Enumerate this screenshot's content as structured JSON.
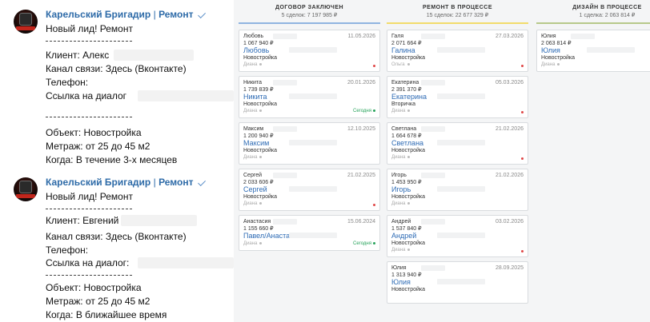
{
  "chat": {
    "messages": [
      {
        "sender": "Карельский Бригадир",
        "sender_suffix": "Ремонт",
        "lines": [
          "Новый лид! Ремонт",
          "Клиент: Алекс",
          "Канал связи: Здесь (Вконтакте)",
          "Телефон:",
          "Ссылка на диалог",
          "Объект: Новостройка",
          "Метраж: от 25 до 45 м2",
          "Когда: В течение 3-х месяцев"
        ]
      },
      {
        "sender": "Карельский Бригадир",
        "sender_suffix": "Ремонт",
        "lines": [
          "Новый лид! Ремонт",
          "Клиент: Евгений",
          "Канал связи: Здесь (Вконтакте)",
          "Телефон:",
          "Ссылка на диалог:",
          "Объект: Новостройка",
          "Метраж: от 25 до 45 м2",
          "Когда: В ближайшее время"
        ]
      }
    ]
  },
  "board": {
    "columns": [
      {
        "title": "ДОГОВОР ЗАКЛЮЧЕН",
        "subtitle": "5 сделок: 7 197 985 ₽",
        "color": "#8fb4e0",
        "cards": [
          {
            "name": "Любовь",
            "date": "11.05.2026",
            "sum": "1 067 940 ₽",
            "contact": "Любовь",
            "object": "Новостройка",
            "resp": "Диана",
            "status": "",
            "red": true
          },
          {
            "name": "Никита",
            "date": "20.01.2026",
            "sum": "1 739 839 ₽",
            "contact": "Никита",
            "object": "Новостройка",
            "resp": "Диана",
            "status": "Сегодня",
            "red": false
          },
          {
            "name": "Максим",
            "date": "12.10.2025",
            "sum": "1 200 940 ₽",
            "contact": "Максим",
            "object": "Новостройка",
            "resp": "Диана",
            "status": "",
            "red": false
          },
          {
            "name": "Сергей",
            "date": "21.02.2025",
            "sum": "2 033 606 ₽",
            "contact": "Сергей",
            "object": "Новостройка",
            "resp": "Диана",
            "status": "",
            "red": true
          },
          {
            "name": "Анастасия",
            "date": "15.06.2024",
            "sum": "1 155 660 ₽",
            "contact": "Павел/Анастасия",
            "object": "",
            "resp": "Диана",
            "status": "Сегодня",
            "red": false
          }
        ]
      },
      {
        "title": "РЕМОНТ В ПРОЦЕССЕ",
        "subtitle": "15 сделок: 22 677 329 ₽",
        "color": "#f2dc6b",
        "cards": [
          {
            "name": "Галя",
            "date": "27.03.2026",
            "sum": "2 071 664 ₽",
            "contact": "Галина",
            "object": "Новостройка",
            "resp": "Ольга",
            "status": "",
            "red": true
          },
          {
            "name": "Екатерина",
            "date": "05.03.2026",
            "sum": "2 391 370 ₽",
            "contact": "Екатерина",
            "object": "Вторичка",
            "resp": "Диана",
            "status": "",
            "red": true
          },
          {
            "name": "Светлана",
            "date": "21.02.2026",
            "sum": "1 664 678 ₽",
            "contact": "Светлана",
            "object": "Новостройка",
            "resp": "Диана",
            "status": "",
            "red": true
          },
          {
            "name": "Игорь",
            "date": "21.02.2026",
            "sum": "1 453 950 ₽",
            "contact": "Игорь",
            "object": "Новостройка",
            "resp": "Диана",
            "status": "",
            "red": false
          },
          {
            "name": "Андрей",
            "date": "03.02.2026",
            "sum": "1 537 840 ₽",
            "contact": "Андрей",
            "object": "Новостройка",
            "resp": "Диана",
            "status": "",
            "red": true
          },
          {
            "name": "Юлия",
            "date": "28.09.2025",
            "sum": "1 313 940 ₽",
            "contact": "Юлия",
            "object": "Новостройка",
            "resp": "",
            "status": "",
            "red": false
          }
        ]
      },
      {
        "title": "ДИЗАЙН В ПРОЦЕССЕ",
        "subtitle": "1 сделка: 2 063 814 ₽",
        "color": "#b7c98a",
        "cards": [
          {
            "name": "Юлия",
            "date": "",
            "sum": "2 063 814 ₽",
            "contact": "Юлия",
            "object": "Новостройка",
            "resp": "Диана",
            "status": "",
            "red": false
          }
        ]
      }
    ]
  }
}
